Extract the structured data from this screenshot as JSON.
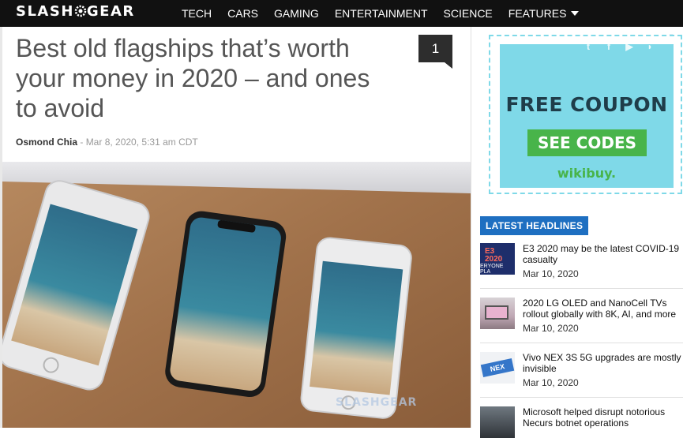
{
  "site": {
    "logo_left": "SLASH",
    "logo_right": "GEAR"
  },
  "nav": {
    "items": [
      {
        "label": "TECH"
      },
      {
        "label": "CARS"
      },
      {
        "label": "GAMING"
      },
      {
        "label": "ENTERTAINMENT"
      },
      {
        "label": "SCIENCE"
      },
      {
        "label": "FEATURES"
      }
    ]
  },
  "article": {
    "title": "Best old flagships that’s worth your money in 2020 – and ones to avoid",
    "comment_count": "1",
    "author": "Osmond Chia",
    "date": "- Mar 8, 2020, 5:31 am CDT",
    "image_watermark": "SLASHGEAR"
  },
  "ad": {
    "title": "FREE COUPON",
    "button": "SEE CODES",
    "brand": "wikibuy.",
    "info_icon": "info-icon",
    "bg_color": "#7fd9e8",
    "button_color": "#48b44a"
  },
  "sidebar": {
    "section_label": "LATEST HEADLINES",
    "headlines": [
      {
        "title": "E3 2020 may be the latest COVID-19 casualty",
        "date": "Mar 10, 2020",
        "thumb_text": "E3 2020",
        "thumb_sub": "ERYONE PLA"
      },
      {
        "title": "2020 LG OLED and NanoCell TVs rollout globally with 8K, AI, and more",
        "date": "Mar 10, 2020"
      },
      {
        "title": "Vivo NEX 3S 5G upgrades are mostly invisible",
        "date": "Mar 10, 2020",
        "thumb_text": "NEX"
      },
      {
        "title": "Microsoft helped disrupt notorious Necurs botnet operations",
        "date": ""
      }
    ]
  },
  "colors": {
    "nav_bg": "#111111",
    "accent_blue": "#1e6fc1",
    "badge_bg": "#2d2d2d"
  }
}
